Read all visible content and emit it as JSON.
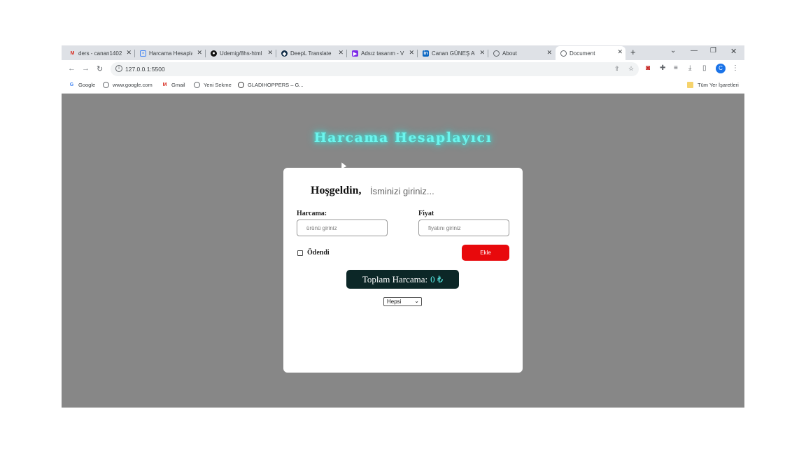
{
  "tabs": [
    {
      "title": "ders - canan1402",
      "icon": "gmail-icon",
      "color": "#d93025"
    },
    {
      "title": "Harcama Hesaplayıcı",
      "icon": "page-icon",
      "color": "#4285f4"
    },
    {
      "title": "Udemig/8hs-html",
      "icon": "github-icon",
      "color": "#111111"
    },
    {
      "title": "DeepL Translate",
      "icon": "deepl-icon",
      "color": "#0f2b46"
    },
    {
      "title": "Adsız tasarım - V",
      "icon": "canva-icon",
      "color": "#7d2ae8"
    },
    {
      "title": "Canan GÜNEŞ Al",
      "icon": "linkedin-icon",
      "color": "#0a66c2"
    },
    {
      "title": "About",
      "icon": "globe-icon",
      "color": "#5f6368"
    },
    {
      "title": "Document",
      "icon": "globe-icon",
      "color": "#5f6368"
    }
  ],
  "address": {
    "url": "127.0.0.1:5500"
  },
  "bookmarks": [
    {
      "label": "Google",
      "icon": "google-icon"
    },
    {
      "label": "www.google.com",
      "icon": "globe-icon"
    },
    {
      "label": "Gmail",
      "icon": "gmail-icon"
    },
    {
      "label": "Yeni Sekme",
      "icon": "globe-icon"
    },
    {
      "label": "GLADIHOPPERS – G...",
      "icon": "gladihoppers-icon"
    }
  ],
  "bookmarks_folder": "Tüm Yer İşaretleri",
  "profile_initial": "C",
  "app": {
    "heading": "Harcama Hesaplayıcı",
    "welcome": "Hoşgeldin,",
    "name_placeholder": "İsminizi giriniz...",
    "expense_label": "Harcama:",
    "expense_placeholder": "ürünü giriniz",
    "price_label": "Fiyat",
    "price_placeholder": "fiyatını giriniz",
    "paid_label": "Ödendi",
    "add_button": "Ekle",
    "total_label": "Toplam Harcama:",
    "total_value": "0 ₺",
    "filter_selected": "Hepsi"
  },
  "colors": {
    "page_bg": "#878787",
    "heading_glow": "#34f0e6",
    "add_button": "#e8090c",
    "total_bg": "#0c2727",
    "total_amount": "#5af0ea"
  }
}
